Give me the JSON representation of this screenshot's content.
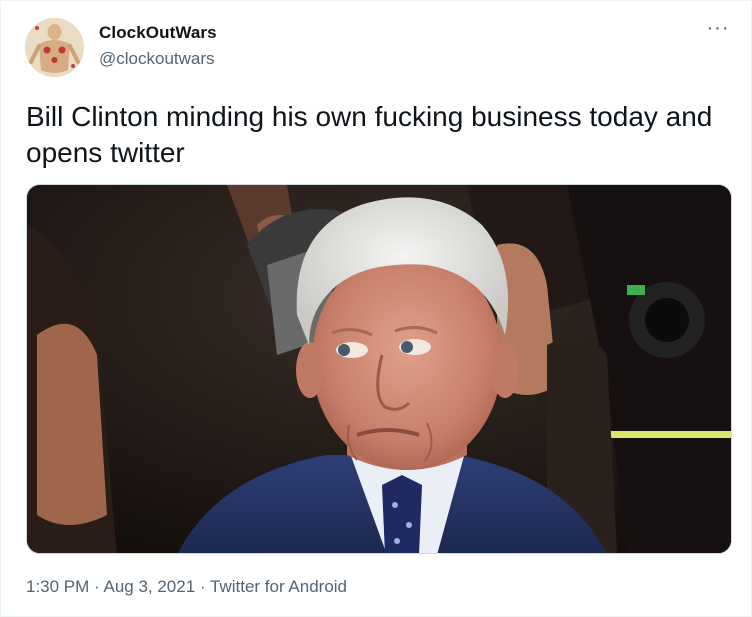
{
  "author": {
    "display_name": "ClockOutWars",
    "handle": "@clockoutwars",
    "avatar_icon": "avatar-figure-icon"
  },
  "menu": {
    "more_label": "···"
  },
  "tweet": {
    "text": "Bill Clinton minding his own fucking business today and opens twitter"
  },
  "media": {
    "type": "photo",
    "description_icon": "photo-man-looking-sideways"
  },
  "meta": {
    "time": "1:30 PM",
    "separator": " · ",
    "date": "Aug 3, 2021",
    "source": "Twitter for Android"
  },
  "colors": {
    "text_primary": "#0f1419",
    "text_secondary": "#536471",
    "border": "#cfd9de"
  }
}
